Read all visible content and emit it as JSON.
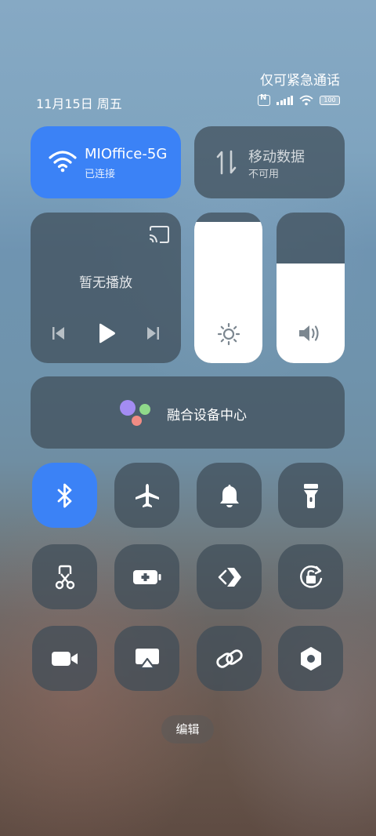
{
  "status_bar": {
    "emergency_text": "仅可紧急通话",
    "date_text": "11月15日 周五",
    "battery_text": "100"
  },
  "wifi": {
    "network": "MIOffice-5G",
    "status": "已连接",
    "active": true
  },
  "mobile_data": {
    "title": "移动数据",
    "status": "不可用",
    "active": false
  },
  "media": {
    "status": "暂无播放"
  },
  "brightness": {
    "level": 0.94
  },
  "volume": {
    "level": 0.66
  },
  "device_hub": {
    "label": "融合设备中心"
  },
  "toggles": [
    {
      "icon": "bluetooth-icon",
      "active": true
    },
    {
      "icon": "airplane-icon",
      "active": false
    },
    {
      "icon": "bell-icon",
      "active": false
    },
    {
      "icon": "flashlight-icon",
      "active": false
    },
    {
      "icon": "screenshot-icon",
      "active": false
    },
    {
      "icon": "battery-saver-icon",
      "active": false
    },
    {
      "icon": "nearby-share-icon",
      "active": false
    },
    {
      "icon": "rotation-lock-icon",
      "active": false
    },
    {
      "icon": "screen-recorder-icon",
      "active": false
    },
    {
      "icon": "cast-screen-icon",
      "active": false
    },
    {
      "icon": "link-icon",
      "active": false
    },
    {
      "icon": "settings-icon",
      "active": false
    }
  ],
  "edit_label": "编辑",
  "colors": {
    "accent": "#3b82f6",
    "tile_dark": "#3e4c58"
  }
}
